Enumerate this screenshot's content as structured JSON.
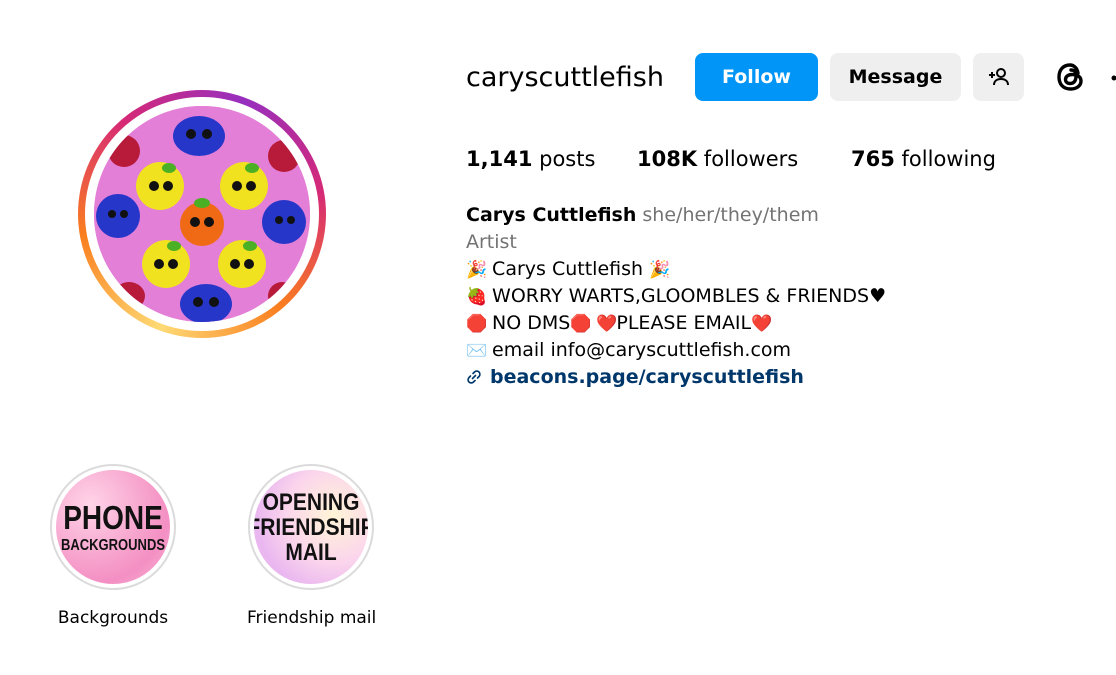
{
  "profile": {
    "username": "caryscuttlefish",
    "follow_label": "Follow",
    "message_label": "Message",
    "add_user_icon": "person-add-icon",
    "threads_icon": "threads-icon"
  },
  "stats": {
    "posts_count": "1,141",
    "posts_label": "posts",
    "followers_count": "108K",
    "followers_label": "followers",
    "following_count": "765",
    "following_label": "following"
  },
  "bio": {
    "name": "Carys Cuttlefish",
    "pronouns": "she/her/they/them",
    "category": "Artist",
    "line1": "Carys Cuttlefish",
    "line2": "WORRY WARTS,GLOOMBLES & FRIENDS",
    "line3a": "NO DMS",
    "line3b": "PLEASE EMAIL",
    "line4": "email info@caryscuttlefish.com",
    "link": "beacons.page/caryscuttlefish",
    "emoji": {
      "party": "🎉",
      "strawberry": "🍓",
      "heart_black": "♥",
      "stop": "🛑",
      "heart_red": "❤️",
      "envelope": "✉️"
    }
  },
  "highlights": [
    {
      "label": "Backgrounds",
      "cover_line1": "PHONE",
      "cover_line2": "BACKGROUNDS"
    },
    {
      "label": "Friendship mail",
      "cover_line1": "OPENING",
      "cover_line2": "FRIENDSHIP",
      "cover_line3": "MAIL"
    }
  ],
  "colors": {
    "follow_button": "#0095f6",
    "secondary_button": "#efefef",
    "link": "#00376b",
    "muted_text": "#737373"
  }
}
